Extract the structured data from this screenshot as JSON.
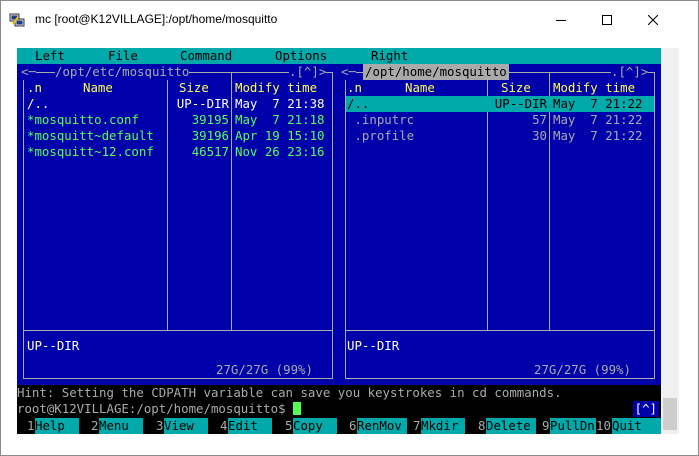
{
  "window": {
    "title": "mc [root@K12VILLAGE]:/opt/home/mosquitto",
    "icon": "putty-icon"
  },
  "menu": [
    "Left",
    "File",
    "Command",
    "Options",
    "Right"
  ],
  "left_panel": {
    "path": "/opt/etc/mosquitto",
    "top_left": "<─",
    "top_right": ".[^]>",
    "headers": {
      "n": ".n",
      "name": "Name",
      "size": "Size",
      "modify": "Modify time"
    },
    "rows": [
      {
        "name": "/..",
        "size": "UP--DIR",
        "modify": "May  7 21:38"
      },
      {
        "name": "*mosquitto.conf",
        "size": "39195",
        "modify": "May  7 21:18"
      },
      {
        "name": "*mosquitt~default",
        "size": "39196",
        "modify": "Apr 19 15:10"
      },
      {
        "name": "*mosquitt~12.conf",
        "size": "46517",
        "modify": "Nov 26 23:16"
      }
    ],
    "status": "UP--DIR",
    "disk": "27G/27G (99%)"
  },
  "right_panel": {
    "path": "/opt/home/mosquitto",
    "top_left": "<─",
    "top_right": ".[^]>",
    "headers": {
      "n": ".n",
      "name": "Name",
      "size": "Size",
      "modify": "Modify time"
    },
    "rows": [
      {
        "name": "/..",
        "size": "UP--DIR",
        "modify": "May  7 21:22"
      },
      {
        "name": " .inputrc",
        "size": "57",
        "modify": "May  7 21:22"
      },
      {
        "name": " .profile",
        "size": "30",
        "modify": "May  7 21:22"
      }
    ],
    "status": "UP--DIR",
    "disk": "27G/27G (99%)"
  },
  "hint": "Hint: Setting the CDPATH variable can save you keystrokes in cd commands.",
  "prompt": "root@K12VILLAGE:/opt/home/mosquitto$ ",
  "prompt_button": "[^]",
  "fkeys": [
    {
      "num": "1",
      "label": "Help"
    },
    {
      "num": "2",
      "label": "Menu"
    },
    {
      "num": "3",
      "label": "View"
    },
    {
      "num": "4",
      "label": "Edit"
    },
    {
      "num": "5",
      "label": "Copy"
    },
    {
      "num": "6",
      "label": "RenMov"
    },
    {
      "num": "7",
      "label": "Mkdir"
    },
    {
      "num": "8",
      "label": "Delete"
    },
    {
      "num": "9",
      "label": "PullDn"
    },
    {
      "num": "10",
      "label": "Quit"
    }
  ],
  "colors": {
    "panel_bg": "#0000aa",
    "cyan": "#00aaaa",
    "header": "#ffff55",
    "exec_file": "#55ff55",
    "frame": "#aaaaaa"
  }
}
